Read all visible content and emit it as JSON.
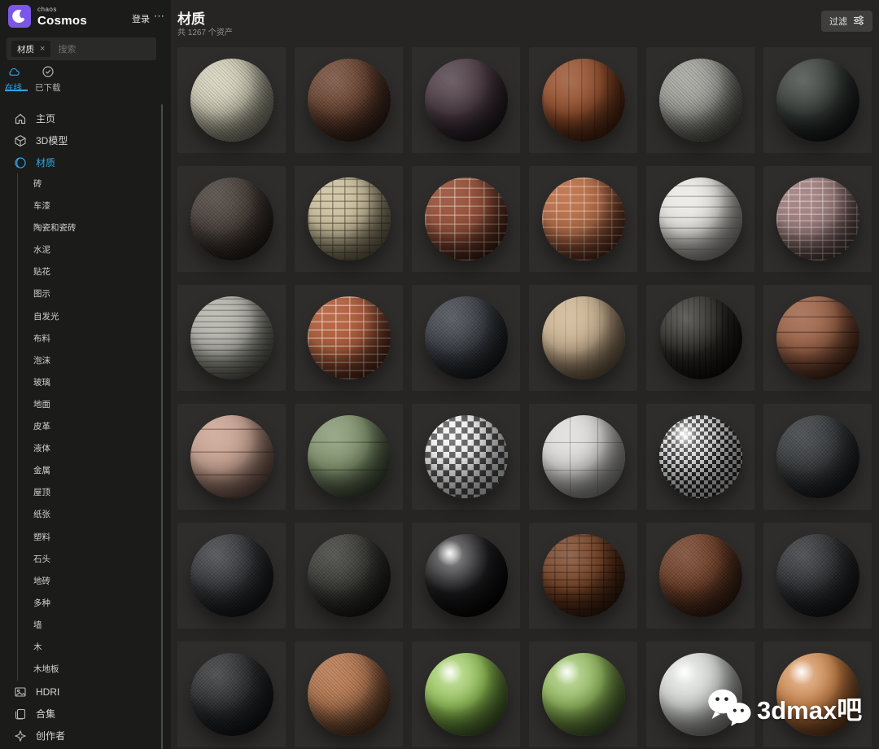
{
  "header": {
    "logo_small": "chaos",
    "logo_large": "Cosmos",
    "login_label": "登录",
    "more_label": "⋯"
  },
  "search": {
    "chip": "材质",
    "chip_close": "×",
    "placeholder": "搜索"
  },
  "tabs": [
    {
      "label": "在线",
      "icon": "cloud-icon",
      "active": true
    },
    {
      "label": "已下载",
      "icon": "check-circle-icon",
      "active": false
    }
  ],
  "sidebar": {
    "items": [
      {
        "label": "主页",
        "icon": "home-icon",
        "type": "main"
      },
      {
        "label": "3D模型",
        "icon": "cube-icon",
        "type": "main"
      },
      {
        "label": "材质",
        "icon": "sphere-icon",
        "type": "main",
        "active": true
      },
      {
        "label": "砖",
        "type": "sub"
      },
      {
        "label": "车漆",
        "type": "sub"
      },
      {
        "label": "陶瓷和瓷砖",
        "type": "sub"
      },
      {
        "label": "水泥",
        "type": "sub"
      },
      {
        "label": "贴花",
        "type": "sub"
      },
      {
        "label": "图示",
        "type": "sub"
      },
      {
        "label": "自发光",
        "type": "sub"
      },
      {
        "label": "布料",
        "type": "sub"
      },
      {
        "label": "泡沫",
        "type": "sub"
      },
      {
        "label": "玻璃",
        "type": "sub"
      },
      {
        "label": "地面",
        "type": "sub"
      },
      {
        "label": "皮革",
        "type": "sub"
      },
      {
        "label": "液体",
        "type": "sub"
      },
      {
        "label": "金属",
        "type": "sub"
      },
      {
        "label": "屋顶",
        "type": "sub"
      },
      {
        "label": "纸张",
        "type": "sub"
      },
      {
        "label": "塑料",
        "type": "sub"
      },
      {
        "label": "石头",
        "type": "sub"
      },
      {
        "label": "地砖",
        "type": "sub"
      },
      {
        "label": "多种",
        "type": "sub"
      },
      {
        "label": "墙",
        "type": "sub"
      },
      {
        "label": "木",
        "type": "sub"
      },
      {
        "label": "木地板",
        "type": "sub"
      },
      {
        "label": "HDRI",
        "icon": "image-icon",
        "type": "main"
      },
      {
        "label": "合集",
        "icon": "collection-icon",
        "type": "main"
      },
      {
        "label": "创作者",
        "icon": "sparkle-icon",
        "type": "main"
      }
    ]
  },
  "main": {
    "title": "材质",
    "count_text": "共 1267 个资产",
    "filter_label": "过滤"
  },
  "watermark": {
    "text": "3dmax吧"
  },
  "colors": {
    "accent_blue": "#2ba7e8",
    "brand_purple": "#7b57e8",
    "sidebar_bg": "#1b1b1a",
    "main_bg": "#262523",
    "tile_bg": "#2e2d2b",
    "button_bg": "#3e3e3d"
  },
  "materials": [
    {
      "name": "cream-leather",
      "base": "#d6d3bc",
      "shade": "#8b8874",
      "pattern": "speckle",
      "gloss": 0.25
    },
    {
      "name": "brown-crackle-leather",
      "base": "#6e4531",
      "shade": "#301e16",
      "pattern": "speckle",
      "gloss": 0.3
    },
    {
      "name": "dark-plum-smooth",
      "base": "#4d3c44",
      "shade": "#211a1f",
      "pattern": "none",
      "gloss": 0.35
    },
    {
      "name": "mahogany-wood",
      "base": "#98522f",
      "shade": "#46220f",
      "pattern": "lines-v",
      "pc": "rgba(50,20,8,0.3)",
      "period": 16,
      "gloss": 0.3
    },
    {
      "name": "gray-stucco",
      "base": "#a6a6a0",
      "shade": "#55554f",
      "pattern": "speckle",
      "gloss": 0.2
    },
    {
      "name": "charcoal-smooth",
      "base": "#3a403c",
      "shade": "#141719",
      "pattern": "none",
      "gloss": 0.4
    },
    {
      "name": "dark-rough-stone",
      "base": "#4e443e",
      "shade": "#211c19",
      "pattern": "speckle",
      "gloss": 0.2
    },
    {
      "name": "cream-brick",
      "base": "#cfc3a2",
      "shade": "#6f6750",
      "pattern": "brick",
      "pc": "rgba(80,70,50,0.55)",
      "rowp": 9,
      "colp": 15,
      "gloss": 0.15
    },
    {
      "name": "red-rough-brick",
      "base": "#99523b",
      "shade": "#411f14",
      "pattern": "brick",
      "pc": "rgba(230,214,192,0.5)",
      "rowp": 11,
      "colp": 18,
      "gloss": 0.12
    },
    {
      "name": "orange-brick",
      "base": "#bb6f49",
      "shade": "#55291a",
      "pattern": "brick",
      "pc": "rgba(243,226,205,0.45)",
      "rowp": 10,
      "colp": 17,
      "gloss": 0.12
    },
    {
      "name": "white-painted-brick",
      "base": "#eceae6",
      "shade": "#8e8d88",
      "pattern": "lines-h",
      "pc": "rgba(140,138,132,0.6)",
      "period": 13,
      "gloss": 0.2
    },
    {
      "name": "aged-purple-brick",
      "base": "#a18081",
      "shade": "#4c3a38",
      "pattern": "brick",
      "pc": "rgba(228,218,208,0.55)",
      "rowp": 8,
      "colp": 14,
      "gloss": 0.12
    },
    {
      "name": "white-slate-stack",
      "base": "#b8b8b0",
      "shade": "#5c5c55",
      "pattern": "lines-h",
      "pc": "rgba(70,70,63,0.45)",
      "period": 7,
      "gloss": 0.15
    },
    {
      "name": "brick-white-mortar",
      "base": "#b25f3d",
      "shade": "#522718",
      "pattern": "brick",
      "pc": "rgba(238,228,212,0.55)",
      "rowp": 10,
      "colp": 17,
      "gloss": 0.12
    },
    {
      "name": "black-crackle-mesh",
      "base": "#3d4249",
      "shade": "#15171b",
      "pattern": "speckle",
      "gloss": 0.3
    },
    {
      "name": "pale-wood",
      "base": "#cfb695",
      "shade": "#6a583f",
      "pattern": "lines-v",
      "pc": "rgba(120,90,55,0.2)",
      "period": 14,
      "gloss": 0.25
    },
    {
      "name": "black-glossy-wood",
      "base": "#312e2a",
      "shade": "#100f0e",
      "pattern": "lines-v",
      "pc": "rgba(0,0,0,0.35)",
      "period": 7,
      "gloss": 0.45
    },
    {
      "name": "brown-wood-planks",
      "base": "#9e6448",
      "shade": "#46281a",
      "pattern": "lines-h",
      "pc": "rgba(48,22,12,0.5)",
      "period": 19,
      "gloss": 0.25
    },
    {
      "name": "pink-wood-planks",
      "base": "#cba695",
      "shade": "#6b5046",
      "pattern": "lines-h",
      "pc": "rgba(85,50,40,0.5)",
      "period": 28,
      "gloss": 0.2
    },
    {
      "name": "sage-green-paint",
      "base": "#83956f",
      "shade": "#3b4634",
      "pattern": "lines-h",
      "pc": "rgba(45,55,40,0.45)",
      "period": 34,
      "gloss": 0.35
    },
    {
      "name": "chrome-checker",
      "base": "#dddddd",
      "shade": "#3a3a3a",
      "pattern": "checker",
      "c1": "#f2f2f2",
      "c2": "#4e4e4e",
      "cell": 15,
      "gloss": 0.5
    },
    {
      "name": "white-tile-grid",
      "base": "#dedddb",
      "shade": "#8b8b86",
      "pattern": "grid",
      "pc": "rgba(110,110,105,0.5)",
      "period": 34,
      "gloss": 0.25
    },
    {
      "name": "carbon-fiber",
      "base": "#cccccc",
      "shade": "#1c1c1c",
      "pattern": "checker",
      "c1": "#dedede",
      "c2": "#2a2a2a",
      "cell": 10,
      "gloss": 0.75
    },
    {
      "name": "black-asphalt",
      "base": "#3c3f42",
      "shade": "#16181a",
      "pattern": "speckle",
      "gloss": 0.2
    },
    {
      "name": "black-grain-leather",
      "base": "#35383c",
      "shade": "#131518",
      "pattern": "speckle",
      "gloss": 0.35
    },
    {
      "name": "black-crinkle",
      "base": "#3d3e39",
      "shade": "#161714",
      "pattern": "speckle",
      "gloss": 0.25
    },
    {
      "name": "jet-black-gloss",
      "base": "#202022",
      "shade": "#050506",
      "pattern": "none",
      "gloss": 0.9
    },
    {
      "name": "croc-brown-leather",
      "base": "#7a4527",
      "shade": "#351c0e",
      "pattern": "brick",
      "pc": "rgba(38,17,8,0.5)",
      "rowp": 9,
      "colp": 15,
      "gloss": 0.35
    },
    {
      "name": "brown-leather",
      "base": "#744128",
      "shade": "#331b10",
      "pattern": "speckle",
      "gloss": 0.25
    },
    {
      "name": "black-pebble-leather",
      "base": "#303336",
      "shade": "#121416",
      "pattern": "speckle",
      "gloss": 0.3
    },
    {
      "name": "black-textured",
      "base": "#2e3033",
      "shade": "#101214",
      "pattern": "speckle",
      "gloss": 0.3
    },
    {
      "name": "terracotta-clay",
      "base": "#bb7c53",
      "shade": "#57351f",
      "pattern": "speckle",
      "gloss": 0.15
    },
    {
      "name": "lime-green-gloss",
      "base": "#95c755",
      "shade": "#3f5c26",
      "pattern": "none",
      "gloss": 0.85
    },
    {
      "name": "green-ceramic-gloss",
      "base": "#92bd5a",
      "shade": "#42592a",
      "pattern": "none",
      "gloss": 0.8
    },
    {
      "name": "white-ceramic-gloss",
      "base": "#d9dbd7",
      "shade": "#848682",
      "pattern": "none",
      "gloss": 0.85
    },
    {
      "name": "orange-ceramic-gloss",
      "base": "#d08547",
      "shade": "#64391c",
      "pattern": "none",
      "gloss": 0.8
    }
  ]
}
